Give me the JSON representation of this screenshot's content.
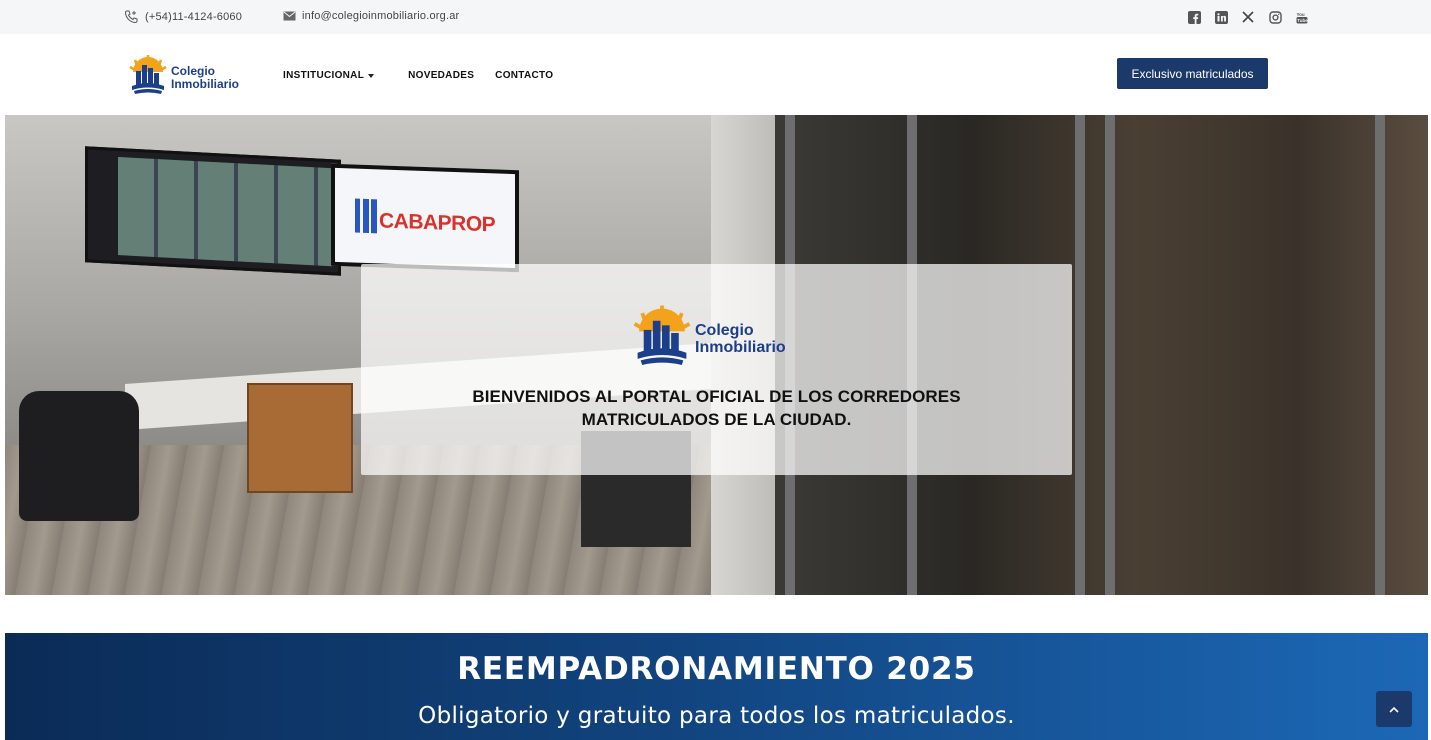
{
  "topbar": {
    "phone": "(+54)11-4124-6060",
    "email": "info@colegioinmobiliario.org.ar",
    "socials": [
      "facebook-icon",
      "linkedin-icon",
      "x-icon",
      "instagram-icon",
      "youtube-icon"
    ]
  },
  "nav": {
    "logo_line1": "Colegio",
    "logo_line2": "Inmobiliario",
    "items": [
      {
        "label": "INSTITUCIONAL",
        "has_dropdown": true
      },
      {
        "label": "NOVEDADES"
      },
      {
        "label": "CONTACTO"
      }
    ],
    "cta": "Exclusivo matriculados"
  },
  "hero": {
    "screen_brand": "CABAPROP",
    "logo_line1": "Colegio",
    "logo_line2": "Inmobiliario",
    "headline_line1": "BIENVENIDOS AL PORTAL OFICIAL DE LOS CORREDORES",
    "headline_line2": "MATRICULADOS DE LA CIUDAD."
  },
  "banner": {
    "title": "REEMPADRONAMIENTO 2025",
    "subtitle": "Obligatorio y gratuito para todos los matriculados."
  },
  "colors": {
    "brand_blue": "#1c3f8c",
    "cta_bg": "#1b3a6b",
    "logo_orange": "#f3a21b"
  }
}
